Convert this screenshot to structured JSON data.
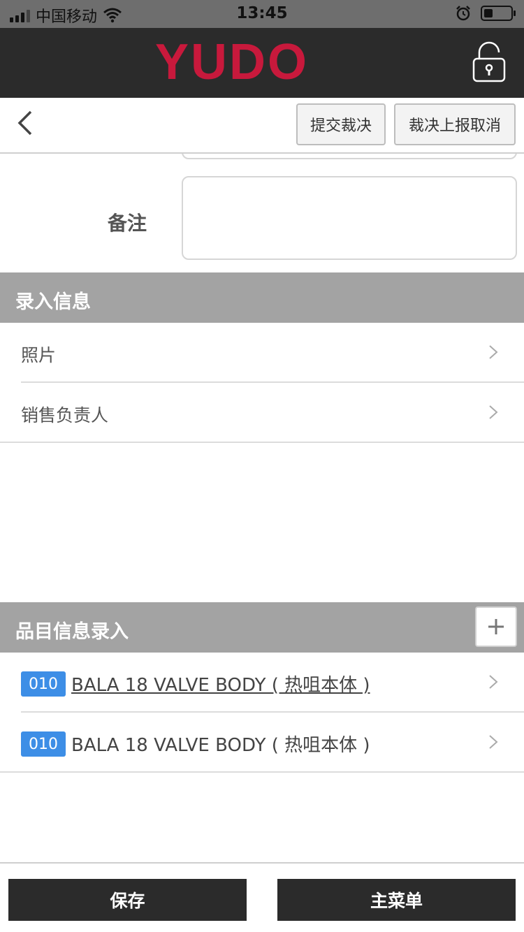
{
  "status_bar": {
    "carrier": "中国移动",
    "time": "13:45"
  },
  "header": {
    "logo_text": "YUDO",
    "brand_color": "#c8193c"
  },
  "toolbar": {
    "submit_label": "提交裁决",
    "cancel_label": "裁决上报取消"
  },
  "form": {
    "remark_label": "备注",
    "remark_value": ""
  },
  "input_section": {
    "title": "录入信息",
    "items": [
      {
        "label": "照片"
      },
      {
        "label": "销售负责人"
      }
    ]
  },
  "item_section": {
    "title": "品目信息录入",
    "items": [
      {
        "code": "010",
        "name": "BALA 18 VALVE BODY ( 热咀本体 )"
      },
      {
        "code": "010",
        "name": "BALA 18 VALVE BODY ( 热咀本体 )"
      }
    ]
  },
  "bottom_bar": {
    "save_label": "保存",
    "main_menu_label": "主菜单"
  },
  "colors": {
    "header_bg": "#2b2b2b",
    "section_bg": "#a3a3a3",
    "badge_bg": "#3d8ee6"
  }
}
